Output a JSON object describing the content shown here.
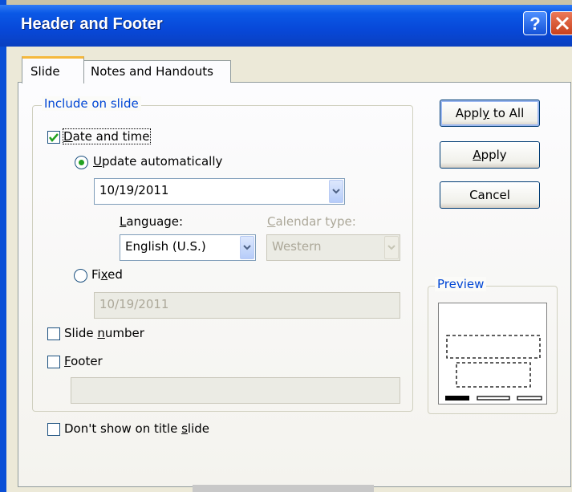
{
  "window": {
    "title": "Header and Footer"
  },
  "tabs": [
    {
      "label": "Slide",
      "active": true
    },
    {
      "label": "Notes and Handouts",
      "active": false
    }
  ],
  "include_group": {
    "legend": "Include on slide",
    "date_time": {
      "label_accel": "D",
      "label_rest": "ate and time",
      "checked": true,
      "update_auto": {
        "label_accel": "U",
        "label_rest": "pdate automatically",
        "selected": true
      },
      "date_value": "10/19/2011",
      "language": {
        "label_accel": "L",
        "label_rest": "anguage:",
        "value": "English (U.S.)"
      },
      "calendar": {
        "label_accel": "C",
        "label_rest": "alendar type:",
        "value": "Western"
      },
      "fixed": {
        "label_pre": "Fi",
        "label_accel": "x",
        "label_rest": "ed",
        "selected": false,
        "value": "10/19/2011"
      }
    },
    "slide_number": {
      "label_pre": "Slide ",
      "label_accel": "n",
      "label_rest": "umber",
      "checked": false
    },
    "footer": {
      "label_accel": "F",
      "label_rest": "ooter",
      "checked": false,
      "value": ""
    }
  },
  "dont_show_title": {
    "label_pre": "Don't show on title ",
    "label_accel": "s",
    "label_rest": "lide",
    "checked": false
  },
  "buttons": {
    "apply_all": {
      "pre": "Appl",
      "accel": "y",
      "rest": " to All"
    },
    "apply": {
      "accel": "A",
      "rest": "pply"
    },
    "cancel": "Cancel"
  },
  "preview": {
    "legend": "Preview"
  },
  "colors": {
    "title_bar": "#0a58e6",
    "legend_text": "#0046d5",
    "radio_dot": "#21a121"
  }
}
